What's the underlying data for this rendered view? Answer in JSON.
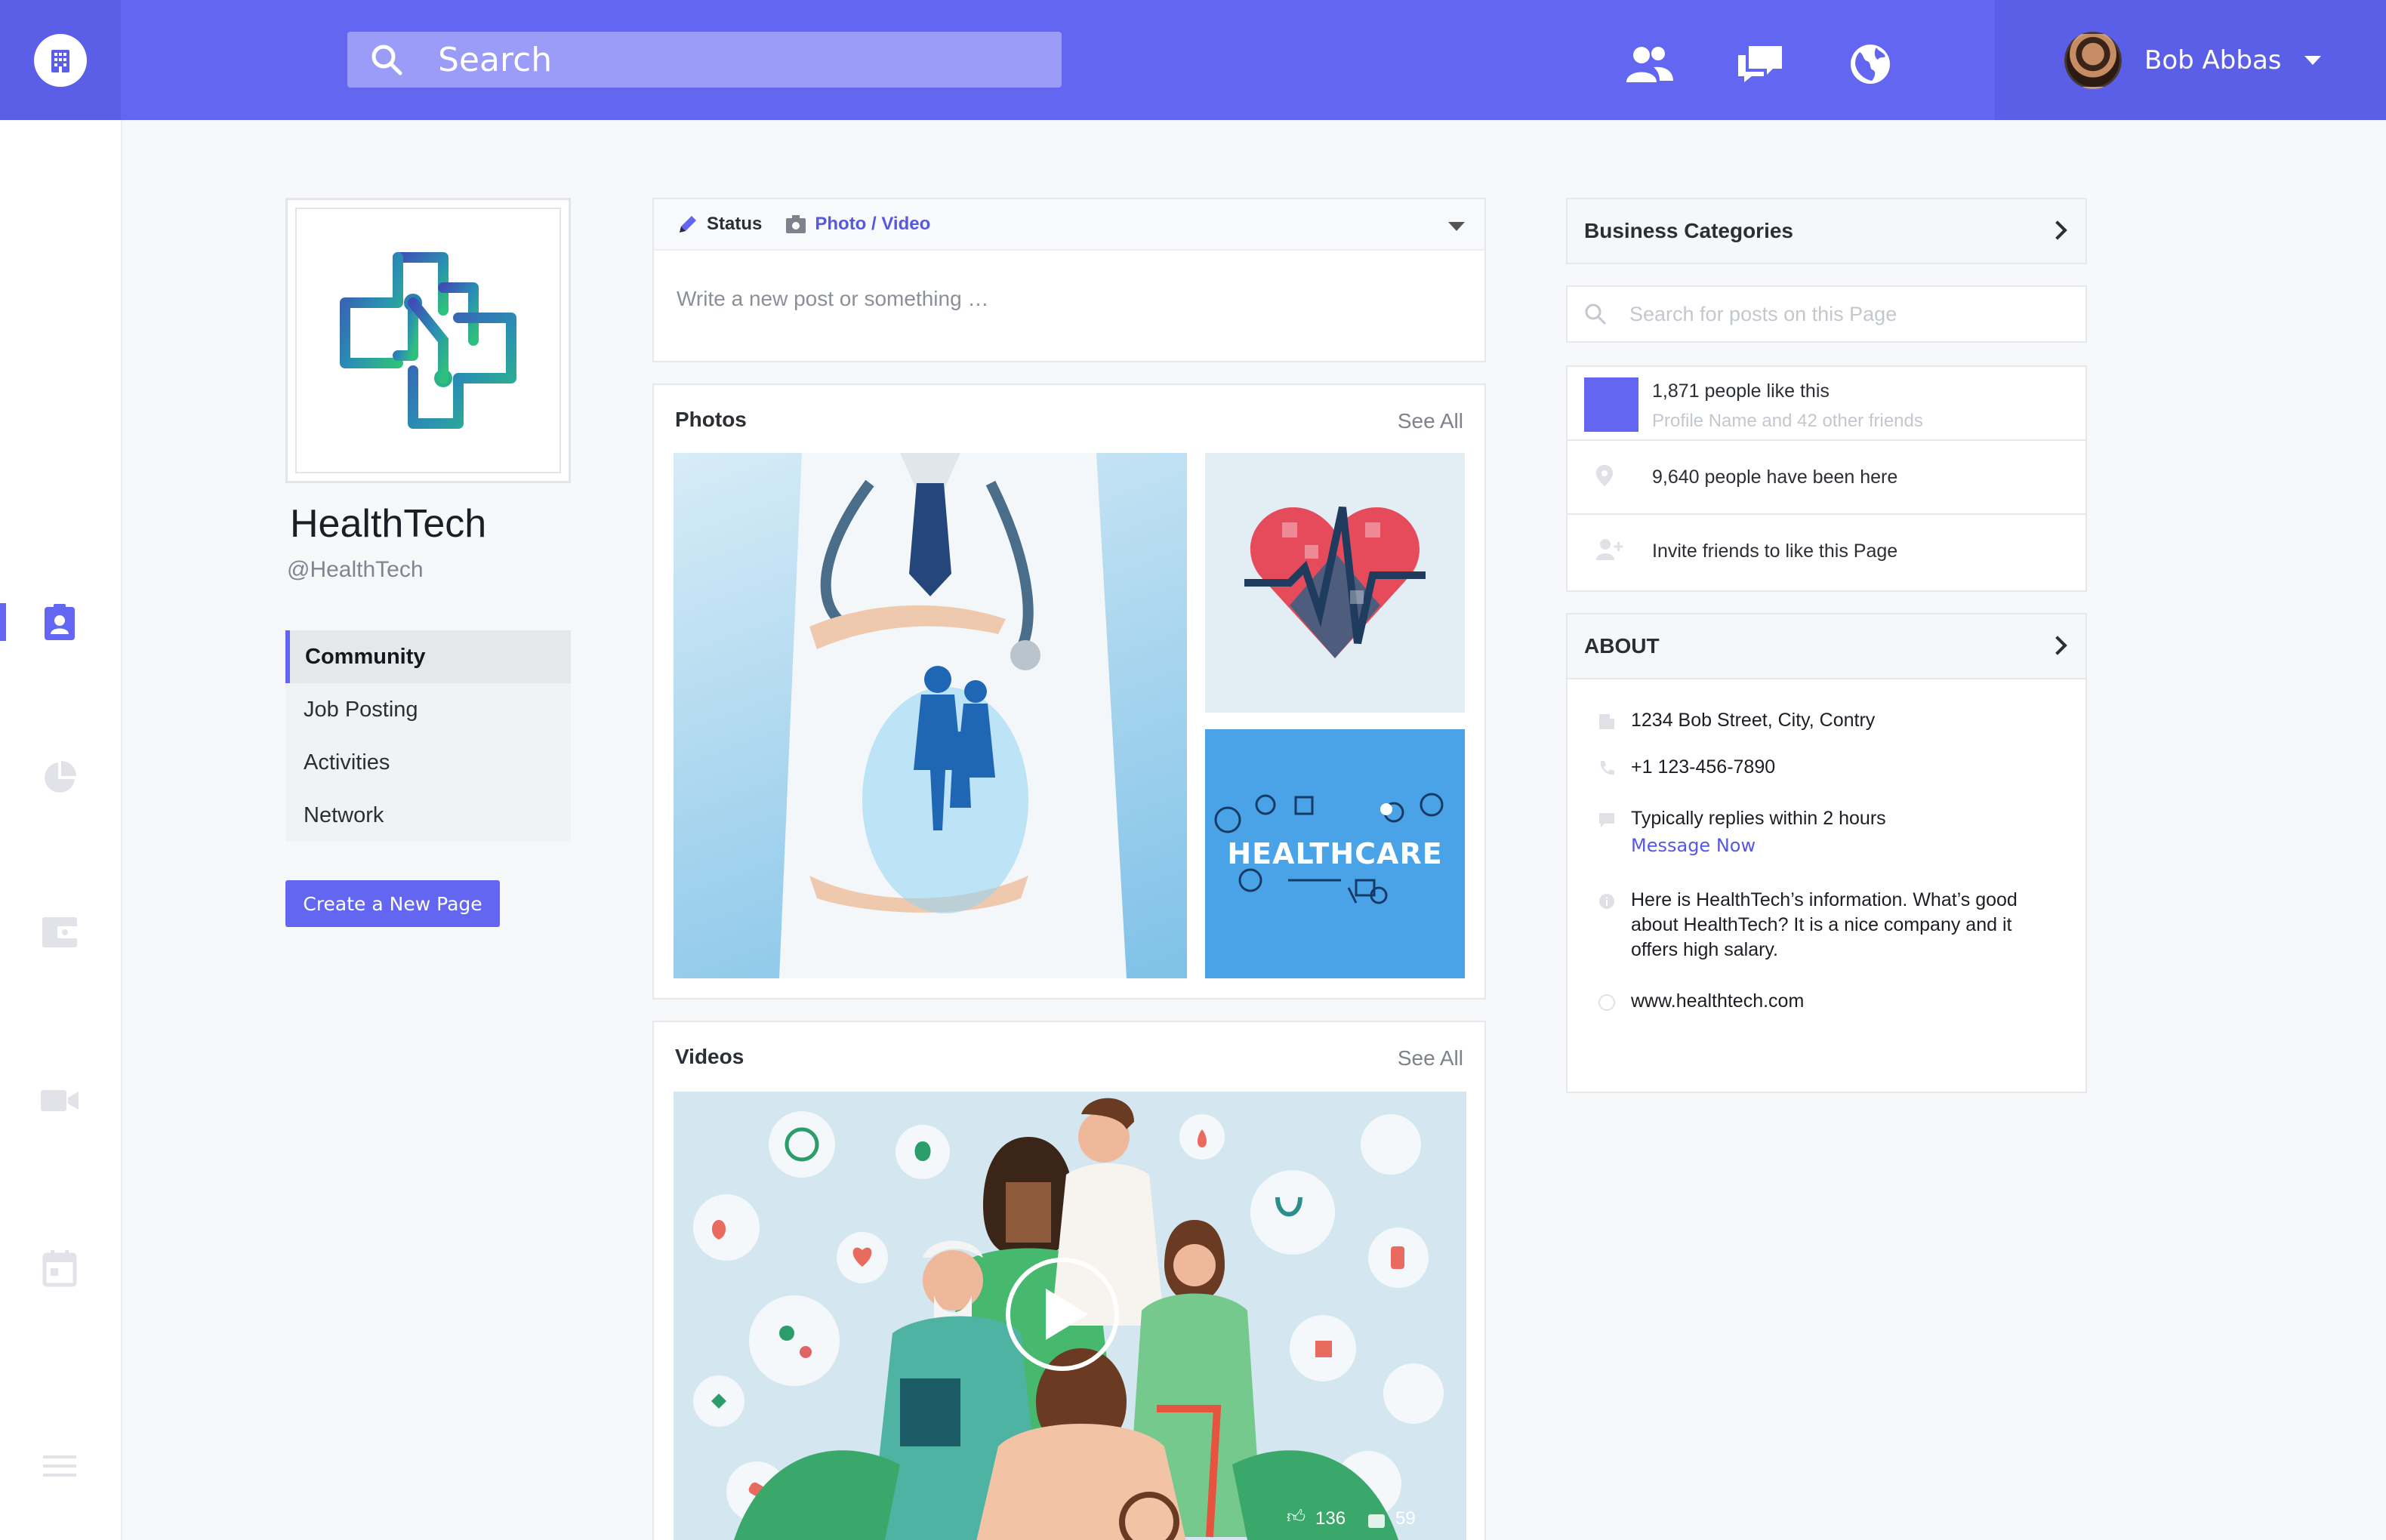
{
  "topbar": {
    "search_placeholder": "Search",
    "user_name": "Bob Abbas"
  },
  "profile": {
    "name": "HealthTech",
    "handle": "@HealthTech",
    "menu": [
      {
        "label": "Community",
        "active": true
      },
      {
        "label": "Job Posting",
        "active": false
      },
      {
        "label": "Activities",
        "active": false
      },
      {
        "label": "Network",
        "active": false
      }
    ],
    "create_button": "Create a New Page"
  },
  "composer": {
    "status_label": "Status",
    "photo_video_label": "Photo / Video",
    "placeholder": "Write a new post or something …"
  },
  "photos": {
    "title": "Photos",
    "see_all": "See All",
    "healthcare_text": "HEALTHCARE"
  },
  "videos": {
    "title": "Videos",
    "see_all": "See All",
    "likes": "136",
    "comments": "59"
  },
  "sidebar_right": {
    "business_categories": "Business Categories",
    "search_placeholder": "Search for posts on this Page",
    "likes_count": "1,871 people like this",
    "likes_friends": "Profile Name and 42 other friends",
    "visits": "9,640 people have been here",
    "invite": "Invite friends to like this Page"
  },
  "about": {
    "title": "ABOUT",
    "address": "1234 Bob Street, City, Contry",
    "phone": "+1 123-456-7890",
    "reply_time": "Typically replies within 2 hours",
    "message_now": "Message Now",
    "info": "Here is HealthTech’s information. What’s good about HealthTech? It is a nice company and it offers high salary.",
    "website": "www.healthtech.com"
  },
  "colors": {
    "accent": "#6366f1",
    "topbar_dark": "#5b5fe8"
  }
}
